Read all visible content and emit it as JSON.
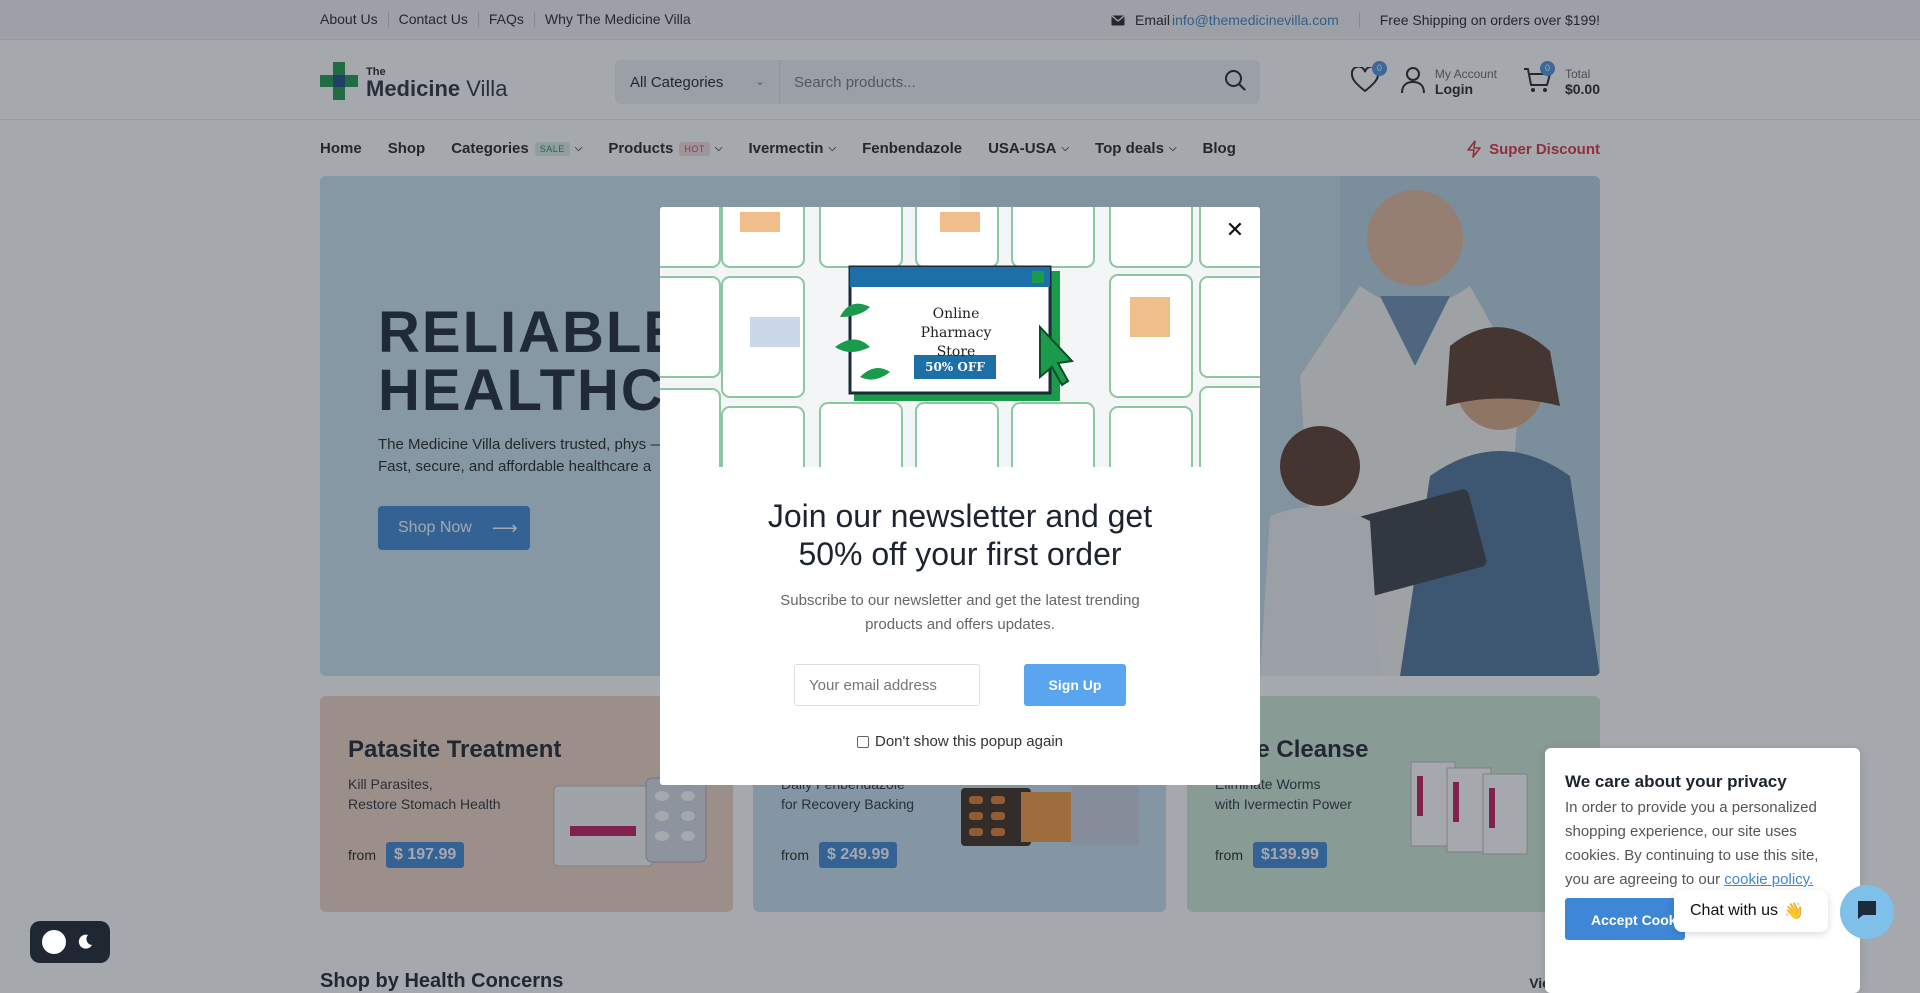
{
  "topbar": {
    "links": [
      "About Us",
      "Contact Us",
      "FAQs",
      "Why The Medicine Villa"
    ],
    "email_label": "Email",
    "email": "info@themedicinevilla.com",
    "shipping": "Free Shipping on orders over $199!"
  },
  "header": {
    "logo_the": "The",
    "logo_name_bold": "Medicine",
    "logo_name_rest": " Villa",
    "category_select": "All Categories",
    "search_placeholder": "Search products...",
    "wishlist_count": "0",
    "account_label": "My Account",
    "account_action": "Login",
    "cart_count": "0",
    "total_label": "Total",
    "total_value": "$0.00"
  },
  "nav": {
    "home": "Home",
    "shop": "Shop",
    "categories": "Categories",
    "categories_tag": "SALE",
    "products": "Products",
    "products_tag": "HOT",
    "ivermectin": "Ivermectin",
    "fenbendazole": "Fenbendazole",
    "usa": "USA-USA",
    "top_deals": "Top deals",
    "blog": "Blog",
    "super_discount": "Super Discount"
  },
  "hero": {
    "title": "RELIABLE\nHEALTHCA",
    "description": "The Medicine Villa delivers trusted, phys — USA, UK, Canada, Australia, Europe & Fast, secure, and affordable healthcare a",
    "button": "Shop Now"
  },
  "cards": [
    {
      "title": "Patasite Treatment",
      "subtitle": "Kill Parasites,\nRestore Stomach Health",
      "from": "from",
      "price": "$ 197.99",
      "bg": "#f0d5c1"
    },
    {
      "title": "",
      "subtitle": "Daily Fenbendazole\nfor Recovery Backing",
      "from": "from",
      "price": "$ 249.99",
      "bg": "#c7e1ef"
    },
    {
      "title": "asite Cleanse",
      "subtitle": "Eliminate Worms\nwith Ivermectin Power",
      "from": "from",
      "price": "$139.99",
      "bg": "#cfe9d6"
    }
  ],
  "section": {
    "title": "Shop by Health Concerns",
    "view_all": "View All"
  },
  "modal": {
    "banner_text": "Online Pharmacy Store",
    "banner_badge": "50% OFF",
    "heading": "Join our newsletter and get 50% off your first order",
    "subtext": "Subscribe to our newsletter and get the latest trending products and offers updates.",
    "email_placeholder": "Your email address",
    "signup": "Sign Up",
    "dont_show": "Don't show this popup again"
  },
  "privacy": {
    "title": "We care about your privacy",
    "body": "In order to provide you a personalized shopping experience, our site uses cookies. By continuing to use this site, you are agreeing to our ",
    "link": "cookie policy.",
    "accept": "Accept Cookies"
  },
  "chat": {
    "label": "Chat with us",
    "emoji": "👋"
  },
  "colors": {
    "accent": "#3e87d6",
    "brand_green": "#1a9a4b",
    "sale": "#2a8a55",
    "hot": "#d04453"
  }
}
